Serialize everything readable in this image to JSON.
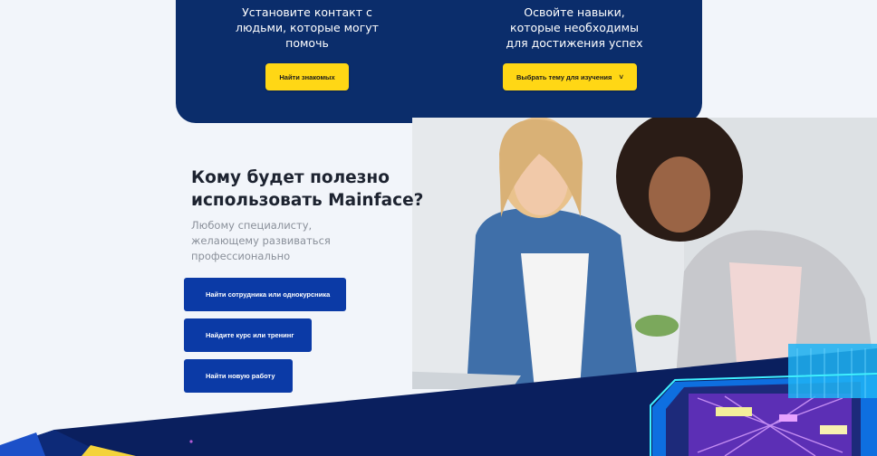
{
  "top_card": {
    "feature1": {
      "lines": [
        "Установите контакт с",
        "людьми, которые могут",
        "помочь"
      ],
      "button": "Найти знакомых"
    },
    "feature2": {
      "lines": [
        "Освойте навыки,",
        "которые необходимы",
        "для достижения успех"
      ],
      "button": "Выбрать тему для изучения",
      "chevron": "˅"
    }
  },
  "who": {
    "title_lines": [
      "Кому будет полезно",
      "использовать Mainface?"
    ],
    "subtitle_lines": [
      "Любому специалисту,",
      "желающему развиваться",
      "профессионально"
    ]
  },
  "cta": {
    "find_colleague": "Найти сотрудника или однокурсника",
    "find_course": "Найдите курс или тренинг",
    "find_job": "Найти новую работу"
  },
  "colors": {
    "navy": "#0b2d6b",
    "yellow": "#ffd715",
    "blue_button": "#0b3aa6",
    "background": "#f2f5fa"
  }
}
